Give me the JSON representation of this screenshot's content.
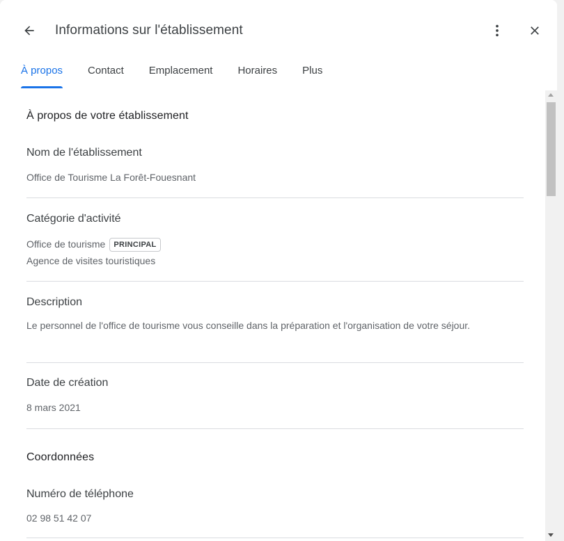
{
  "header": {
    "title": "Informations sur l'établissement",
    "back_icon": "arrow-left-icon",
    "more_icon": "more-vert-icon",
    "close_icon": "close-icon"
  },
  "tabs": [
    {
      "label": "À propos",
      "active": true
    },
    {
      "label": "Contact",
      "active": false
    },
    {
      "label": "Emplacement",
      "active": false
    },
    {
      "label": "Horaires",
      "active": false
    },
    {
      "label": "Plus",
      "active": false
    }
  ],
  "about": {
    "heading": "À propos de votre établissement",
    "name_label": "Nom de l'établissement",
    "name_value": "Office de Tourisme La Forêt-Fouesnant",
    "category_label": "Catégorie d'activité",
    "primary_category": "Office de tourisme",
    "primary_badge": "PRINCIPAL",
    "secondary_category": "Agence de visites touristiques",
    "description_label": "Description",
    "description_value": "Le personnel de l'office de tourisme vous conseille dans la préparation et l'organisation de votre séjour.",
    "date_label": "Date de création",
    "date_value": "8 mars 2021"
  },
  "contact": {
    "heading": "Coordonnées",
    "phone_label": "Numéro de téléphone",
    "phone_value": "02 98 51 42 07"
  },
  "colors": {
    "accent": "#1a73e8",
    "text_primary": "#202124",
    "text_secondary": "#5f6368",
    "divider": "#dadce0"
  }
}
